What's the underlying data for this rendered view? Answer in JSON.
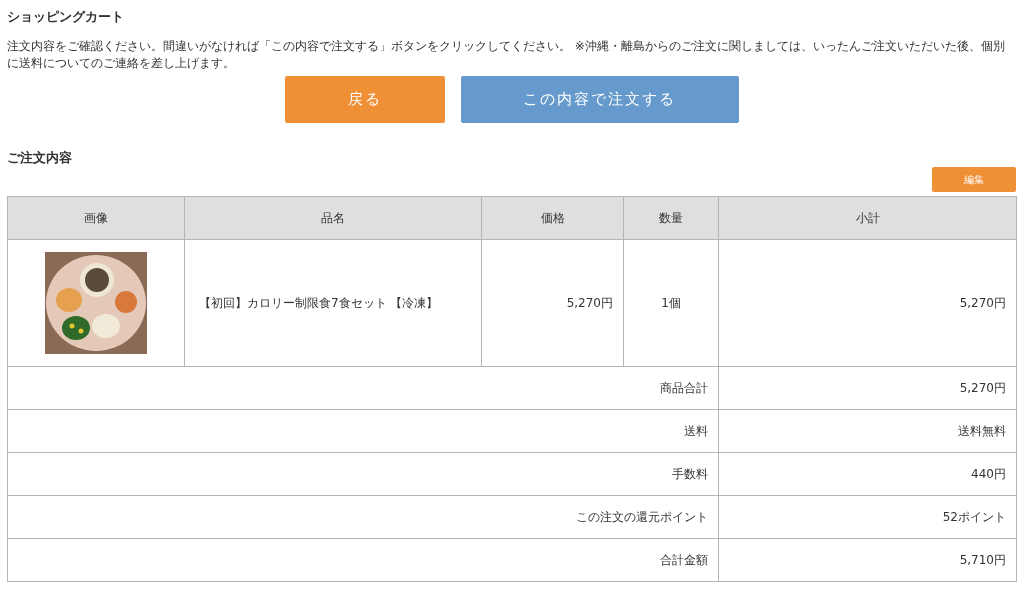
{
  "page_title": "ショッピングカート",
  "notice": "注文内容をご確認ください。間違いがなければ「この内容で注文する」ボタンをクリックしてください。 ※沖縄・離島からのご注文に関しましては、いったんご注文いただいた後、個別に送料についてのご連絡を差し上げます。",
  "buttons": [
    {
      "label": "戻る",
      "kind": "back"
    },
    {
      "label": "この内容で注文する",
      "kind": "confirm"
    }
  ],
  "order": {
    "title": "ご注文内容",
    "edit_button": "編集",
    "columns": [
      "画像",
      "品名",
      "価格",
      "数量",
      "小計"
    ],
    "items": [
      {
        "name": "【初回】カロリー制限食7食セット 【冷凍】",
        "price": "5,270円",
        "quantity": "1個",
        "subtotal": "5,270円"
      }
    ],
    "summary": [
      {
        "label": "商品合計",
        "value": "5,270円"
      },
      {
        "label": "送料",
        "value": "送料無料"
      },
      {
        "label": "手数料",
        "value": "440円"
      },
      {
        "label": "この注文の還元ポイント",
        "value": "52ポイント"
      },
      {
        "label": "合計金額",
        "value": "5,710円"
      }
    ]
  }
}
